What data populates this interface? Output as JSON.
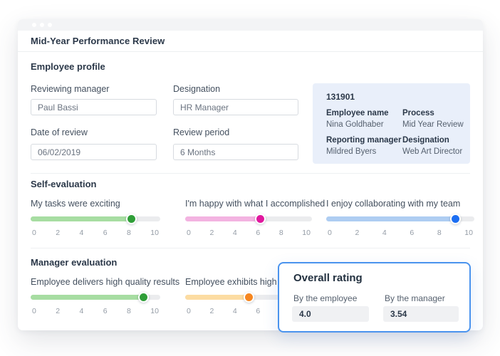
{
  "colors": {
    "accent_blue": "#4a93ee",
    "info_card_bg": "#e9effa",
    "titlebar_bg": "#f3f4f6",
    "divider": "#edeff1",
    "track_rest": "#ebecee"
  },
  "window": {
    "title": "Mid-Year Performance Review",
    "controls_icon": "three-dots"
  },
  "profile": {
    "heading": "Employee profile",
    "fields": [
      {
        "label": "Reviewing manager",
        "value": "Paul Bassi"
      },
      {
        "label": "Designation",
        "value": "HR Manager"
      },
      {
        "label": "Date of review",
        "value": "06/02/2019"
      },
      {
        "label": "Review period",
        "value": "6 Months"
      }
    ],
    "summary": {
      "id": "131901",
      "items": [
        {
          "label": "Employee name",
          "value": "Nina Goldhaber"
        },
        {
          "label": "Process",
          "value": "Mid Year Review"
        },
        {
          "label": "Reporting manager",
          "value": "Mildred Byers"
        },
        {
          "label": "Designation",
          "value": "Web Art Director"
        }
      ]
    }
  },
  "slider_scale": {
    "min": 0,
    "max": 10,
    "ticks": [
      "0",
      "2",
      "4",
      "6",
      "8",
      "10"
    ]
  },
  "self_evaluation": {
    "heading": "Self-evaluation",
    "sliders": [
      {
        "label": "My tasks were exciting",
        "value": 8,
        "fill_color": "#a7dda2",
        "handle_color": "#2f9e38"
      },
      {
        "label": "I'm happy with what I accomplished",
        "value": 6,
        "fill_color": "#f3b3e1",
        "handle_color": "#e0189e"
      },
      {
        "label": "I enjoy collaborating with my team",
        "value": 9,
        "fill_color": "#aecdf2",
        "handle_color": "#1c6ef2"
      }
    ]
  },
  "manager_evaluation": {
    "heading": "Manager evaluation",
    "sliders": [
      {
        "label": "Employee delivers high quality results",
        "value": 9,
        "fill_color": "#a7dda2",
        "handle_color": "#2f9e38"
      },
      {
        "label": "Employee exhibits high le",
        "value": 5,
        "fill_color": "#fcdca2",
        "handle_color": "#f6861f"
      }
    ]
  },
  "overall_rating": {
    "heading": "Overall rating",
    "fields": [
      {
        "label": "By the employee",
        "value": "4.0"
      },
      {
        "label": "By the manager",
        "value": "3.54"
      }
    ]
  }
}
